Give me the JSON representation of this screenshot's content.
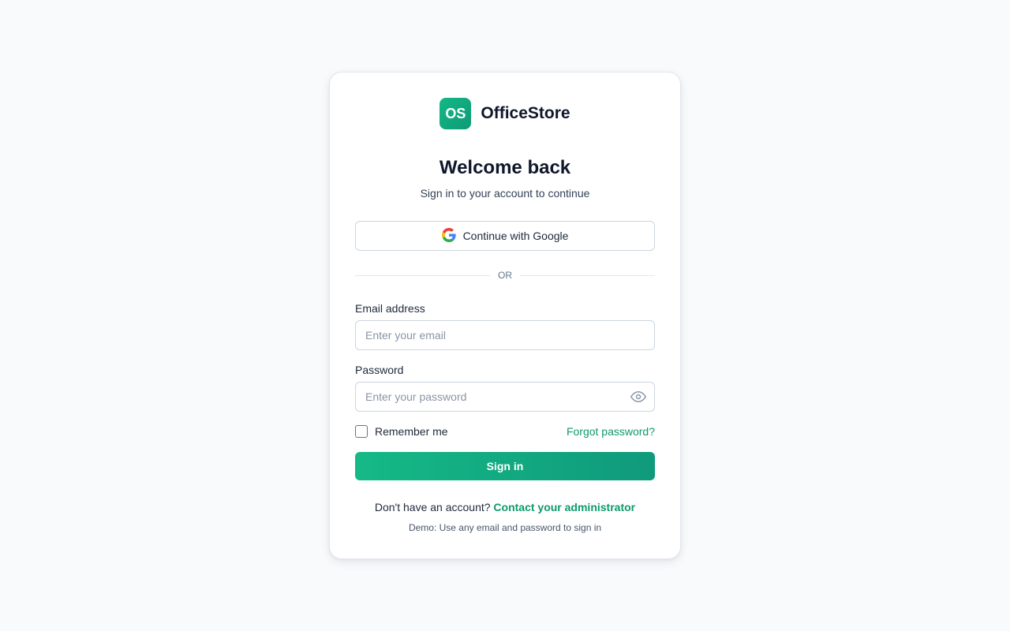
{
  "brand": {
    "logo_text": "OS",
    "name": "OfficeStore",
    "accent": "#10b981"
  },
  "header": {
    "title": "Welcome back",
    "subtitle": "Sign in to your account to continue"
  },
  "google_button": {
    "label": "Continue with Google",
    "icon": "google-icon"
  },
  "divider": {
    "text": "OR"
  },
  "email": {
    "label": "Email address",
    "placeholder": "Enter your email",
    "value": ""
  },
  "password": {
    "label": "Password",
    "placeholder": "Enter your password",
    "value": "",
    "toggle_icon": "eye-icon"
  },
  "remember": {
    "label": "Remember me",
    "checked": false
  },
  "forgot": {
    "label": "Forgot password?"
  },
  "signin": {
    "label": "Sign in"
  },
  "signup": {
    "prompt": "Don't have an account?",
    "link": "Contact your administrator"
  },
  "demo_note": "Demo: Use any email and password to sign in"
}
